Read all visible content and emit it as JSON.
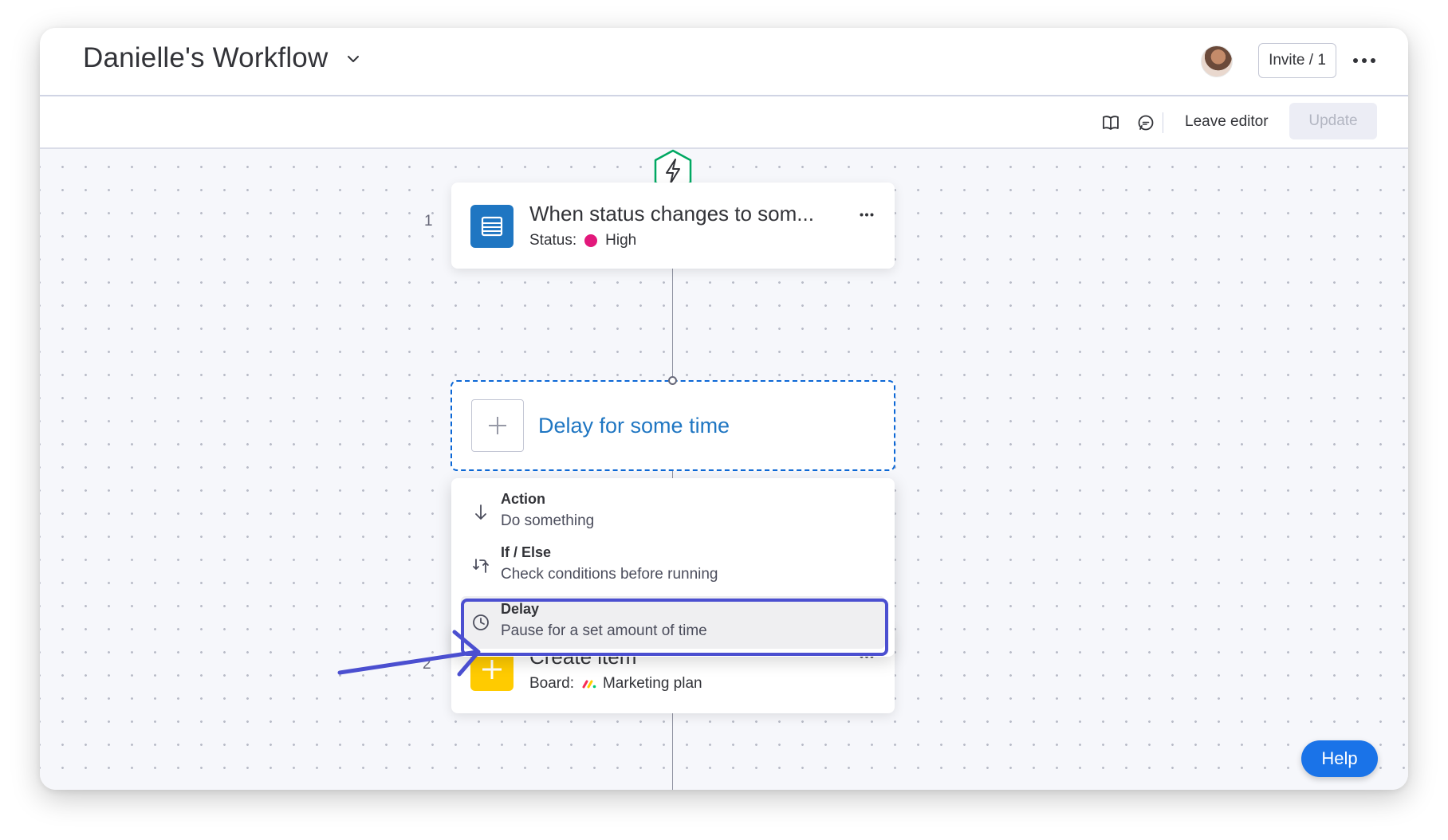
{
  "header": {
    "title": "Danielle's Workflow",
    "invite_label": "Invite / 1"
  },
  "toolbar": {
    "leave_editor_label": "Leave editor",
    "update_label": "Update"
  },
  "workflow": {
    "trigger": {
      "step_number": "1",
      "title": "When status changes to som...",
      "sub_label": "Status:",
      "sub_value": "High",
      "status_color": "#e2187b"
    },
    "placeholder": {
      "label": "Delay for some time"
    },
    "menu": {
      "items": [
        {
          "title": "Action",
          "description": "Do something",
          "icon": "arrow-down-icon"
        },
        {
          "title": "If / Else",
          "description": "Check conditions before running",
          "icon": "branch-icon"
        },
        {
          "title": "Delay",
          "description": "Pause for a set amount of time",
          "icon": "clock-icon"
        }
      ]
    },
    "action": {
      "step_number": "2",
      "title": "Create item",
      "sub_label": "Board:",
      "sub_value": "Marketing plan"
    }
  },
  "help_label": "Help",
  "colors": {
    "accent": "#0b67d6",
    "highlight": "#4b4fd0",
    "trigger_icon_bg": "#1f76c2",
    "action_icon_bg": "#ffcb00",
    "trigger_badge": "#00a862"
  }
}
